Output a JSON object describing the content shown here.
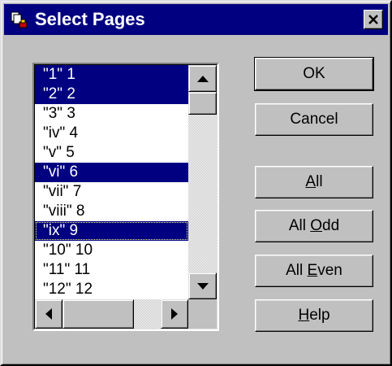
{
  "window": {
    "title": "Select Pages",
    "icon": "pages-icon",
    "close_icon": "close-icon"
  },
  "pages_list": {
    "items": [
      {
        "label": "\"1\" 1",
        "selected": true,
        "focused": false
      },
      {
        "label": "\"2\" 2",
        "selected": true,
        "focused": false
      },
      {
        "label": "\"3\" 3",
        "selected": false,
        "focused": false
      },
      {
        "label": "\"iv\" 4",
        "selected": false,
        "focused": false
      },
      {
        "label": "\"v\" 5",
        "selected": false,
        "focused": false
      },
      {
        "label": "\"vi\" 6",
        "selected": true,
        "focused": false
      },
      {
        "label": "\"vii\" 7",
        "selected": false,
        "focused": false
      },
      {
        "label": "\"viii\" 8",
        "selected": false,
        "focused": false
      },
      {
        "label": "\"ix\" 9",
        "selected": true,
        "focused": true
      },
      {
        "label": "\"10\" 10",
        "selected": false,
        "focused": false
      },
      {
        "label": "\"11\" 11",
        "selected": false,
        "focused": false
      },
      {
        "label": "\"12\" 12",
        "selected": false,
        "focused": false
      }
    ]
  },
  "buttons": {
    "ok": {
      "pre": "OK",
      "mn": "",
      "post": ""
    },
    "cancel": {
      "pre": "Cancel",
      "mn": "",
      "post": ""
    },
    "all": {
      "pre": "",
      "mn": "A",
      "post": "ll"
    },
    "all_odd": {
      "pre": "All ",
      "mn": "O",
      "post": "dd"
    },
    "all_even": {
      "pre": "All ",
      "mn": "E",
      "post": "ven"
    },
    "help": {
      "pre": "",
      "mn": "H",
      "post": "elp"
    }
  },
  "colors": {
    "selection": "#000080",
    "face": "#c0c0c0",
    "titlebar": "#000080"
  }
}
